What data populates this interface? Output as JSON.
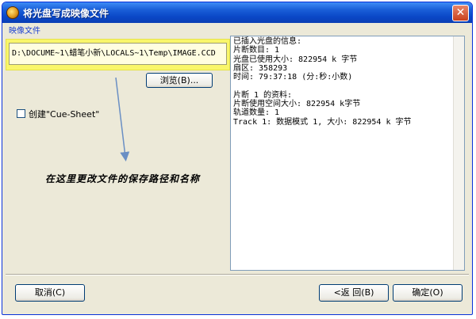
{
  "window": {
    "title": "将光盘写成映像文件",
    "close_symbol": "✕"
  },
  "section_label": "映像文件",
  "path_input": {
    "value": "D:\\DOCUME~1\\蜡笔小新\\LOCALS~1\\Temp\\IMAGE.CCD"
  },
  "browse_button": "浏览(B)...",
  "checkbox": {
    "label": "创建\"Cue-Sheet\"",
    "checked": false
  },
  "info_lines": [
    "已插入光盘的信息:",
    "片断数目: 1",
    "光盘已使用大小: 822954 k 字节",
    "扇区: 358293",
    "时间: 79:37:18 (分:秒:小数)",
    "",
    "片断 1 的资料:",
    "片断使用空间大小: 822954 k字节",
    "轨道数量: 1",
    "Track 1: 数据模式 1, 大小: 822954 k 字节"
  ],
  "annotation": "在这里更改文件的保存路径和名称",
  "buttons": {
    "cancel": "取消(C)",
    "back": "<返 回(B)",
    "ok": "确定(O)"
  },
  "colors": {
    "highlight": "#f9f66a",
    "titlebar": "#0a47c7",
    "arrow": "#6a8fc4"
  }
}
